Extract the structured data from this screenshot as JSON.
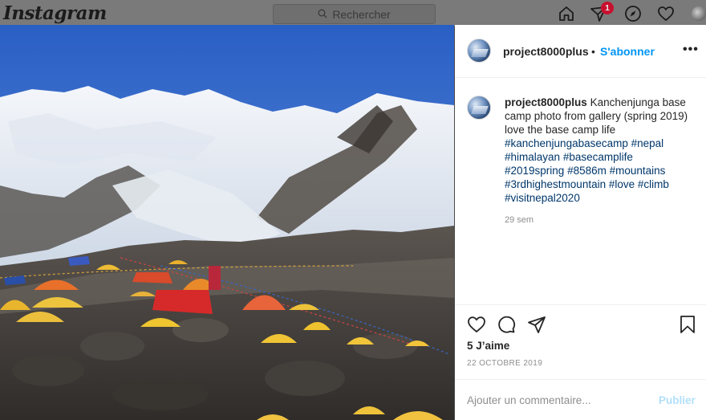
{
  "topbar": {
    "logo": "Instagram",
    "search_placeholder": "Rechercher",
    "notification_count": "1",
    "icons": [
      "home-icon",
      "direct-icon",
      "explore-icon",
      "heart-icon",
      "avatar"
    ]
  },
  "post": {
    "username": "project8000plus",
    "separator": "•",
    "follow_label": "S'abonner",
    "more_label": "•••",
    "caption": {
      "username": "project8000plus",
      "text": "Kanchenjunga base camp photo from gallery (spring 2019) love the base camp life",
      "hashtags": [
        "#kanchenjungabasecamp",
        "#nepal",
        "#himalayan",
        "#basecamplife",
        "#2019spring",
        "#8586m",
        "#mountains",
        "#3rdhighestmountain",
        "#love",
        "#climb",
        "#visitnepal2020"
      ],
      "time": "29 sem"
    },
    "likes": "5 J’aime",
    "date": "22 OCTOBRE 2019",
    "comment_placeholder": "Ajouter un commentaire...",
    "publish_label": "Publier"
  },
  "colors": {
    "link": "#0095f6",
    "hashtag": "#00376b",
    "muted": "#8e8e8e",
    "publish_disabled": "#b2dffc"
  }
}
